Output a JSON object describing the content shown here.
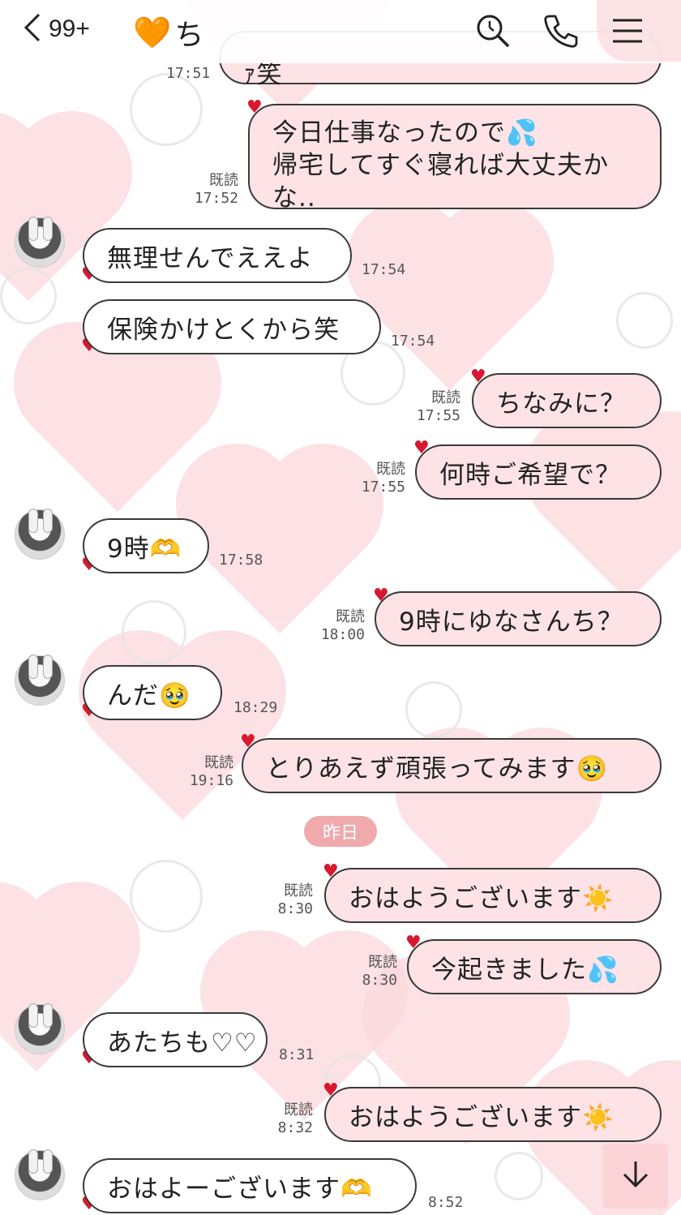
{
  "header": {
    "unread_count": "99+",
    "title_prefix": "🧡",
    "title": "ち",
    "icons": [
      "search-icon",
      "phone-icon",
      "menu-icon"
    ]
  },
  "colors": {
    "bubble_out": "#fde3e6",
    "bubble_in": "#ffffff",
    "tail_heart": "#d8182e",
    "date_badge": "#f0a9ad",
    "background_heart": "#fbd9dc"
  },
  "read_label": "既読",
  "date_separator": "昨日",
  "messages": [
    {
      "side": "out",
      "text": "ｧ笑",
      "time": "17:51",
      "read": false
    },
    {
      "side": "out",
      "text_lines": [
        "今日仕事なったので💦",
        "帰宅してすぐ寝れば大丈夫か",
        "な.."
      ],
      "time": "17:52",
      "read": true
    },
    {
      "side": "in",
      "text": "無理せんでええよ",
      "time": "17:54",
      "avatar": true
    },
    {
      "side": "in",
      "text": "保険かけとくから笑",
      "time": "17:54",
      "avatar": false
    },
    {
      "side": "out",
      "text": "ちなみに？",
      "time": "17:55",
      "read": true
    },
    {
      "side": "out",
      "text": "何時ご希望で？",
      "time": "17:55",
      "read": true
    },
    {
      "side": "in",
      "text": "9時🫶",
      "time": "17:58",
      "avatar": true
    },
    {
      "side": "out",
      "text": "9時にゆなさんち？",
      "time": "18:00",
      "read": true
    },
    {
      "side": "in",
      "text": "んだ🥹",
      "time": "18:29",
      "avatar": true
    },
    {
      "side": "out",
      "text": "とりあえず頑張ってみます🥹",
      "time": "19:16",
      "read": true
    },
    {
      "side": "out",
      "text": "おはようございます☀️",
      "time": "8:30",
      "read": true
    },
    {
      "side": "out",
      "text": "今起きました💦",
      "time": "8:30",
      "read": true
    },
    {
      "side": "in",
      "text": "あたちも♡♡",
      "time": "8:31",
      "avatar": true
    },
    {
      "side": "out",
      "text": "おはようございます☀️",
      "time": "8:32",
      "read": true
    },
    {
      "side": "in",
      "text": "おはよーございます🫶",
      "time": "8:52",
      "avatar": true
    }
  ],
  "scroll_button_icon": "arrow-down-icon"
}
